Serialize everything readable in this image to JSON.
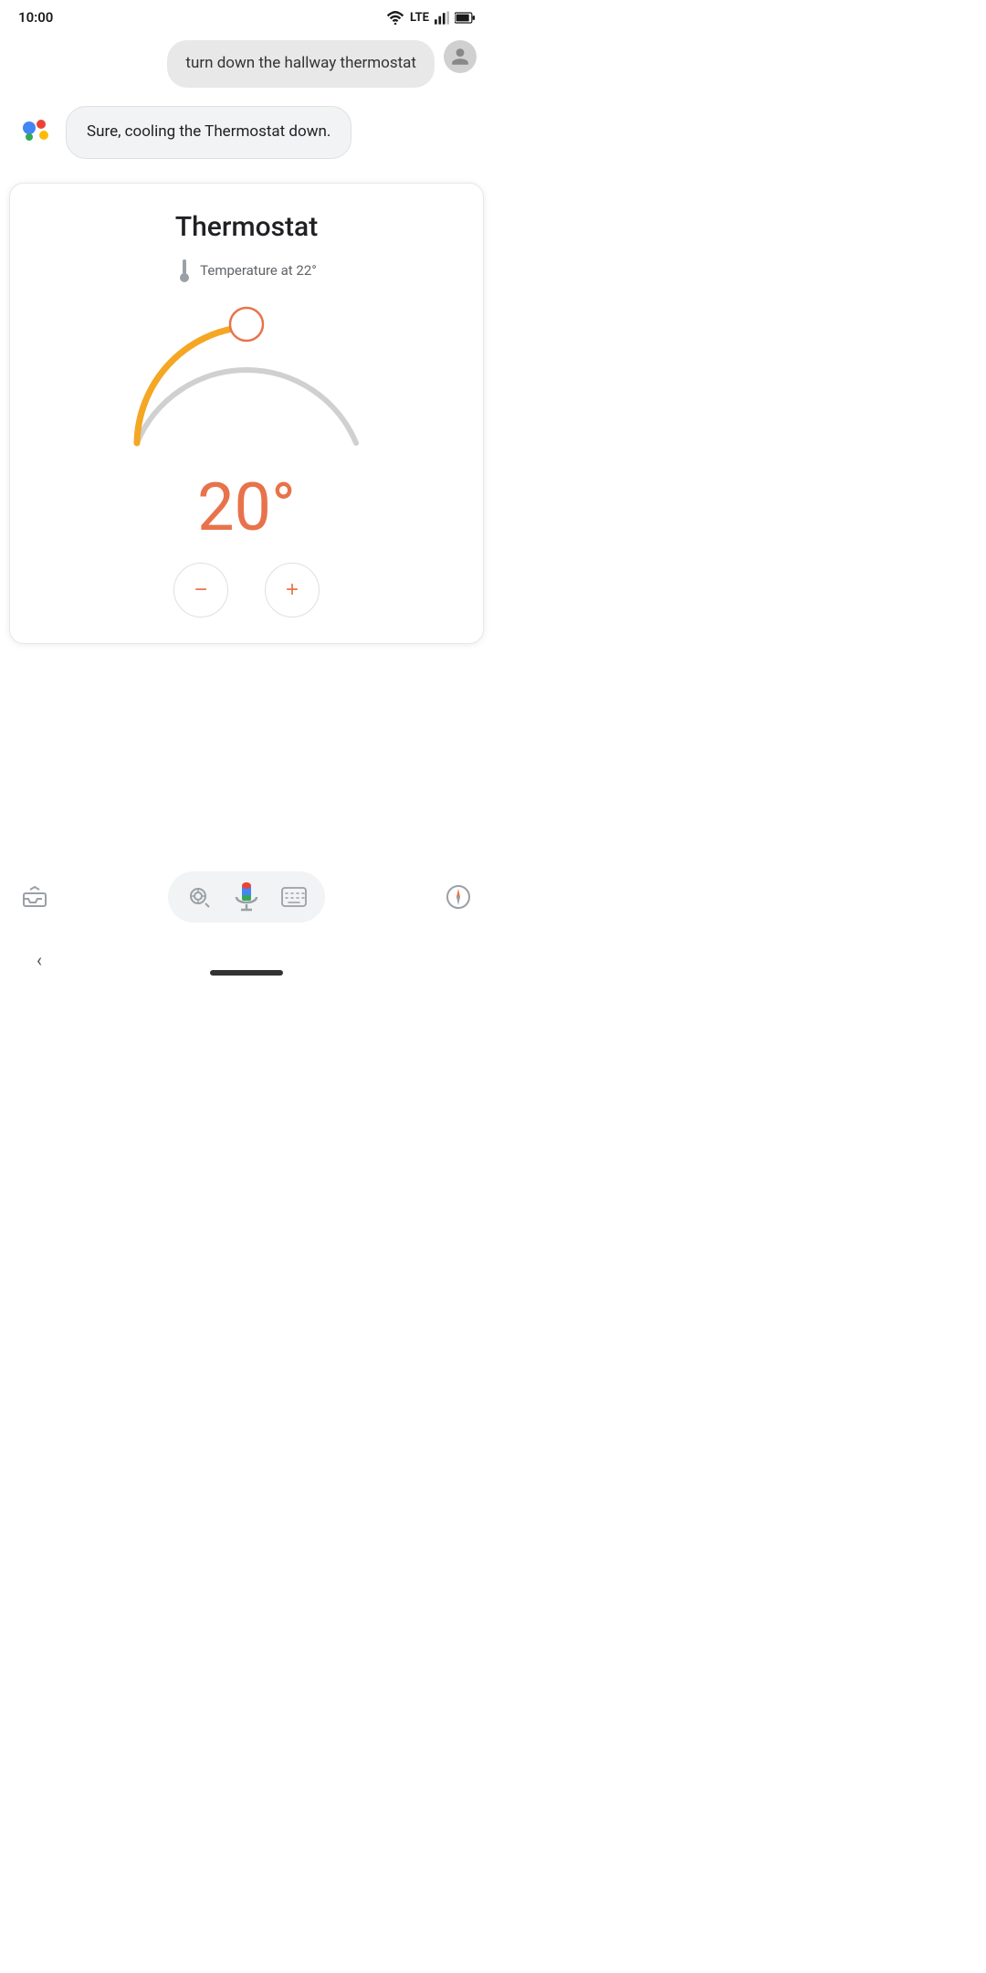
{
  "status": {
    "time": "10:00"
  },
  "chat": {
    "user_message": "turn down the hallway thermostat",
    "assistant_message": "Sure, cooling the Thermostat down."
  },
  "thermostat": {
    "title": "Thermostat",
    "temp_label": "Temperature at 22°",
    "current_temp": "20°",
    "colors": {
      "active_arc": "#f5a623",
      "inactive_arc": "#d0d0d0",
      "handle": "#e8734a",
      "temp_text": "#e8734a"
    }
  },
  "controls": {
    "decrease_label": "−",
    "increase_label": "+"
  },
  "bottom": {
    "back_label": "‹"
  }
}
